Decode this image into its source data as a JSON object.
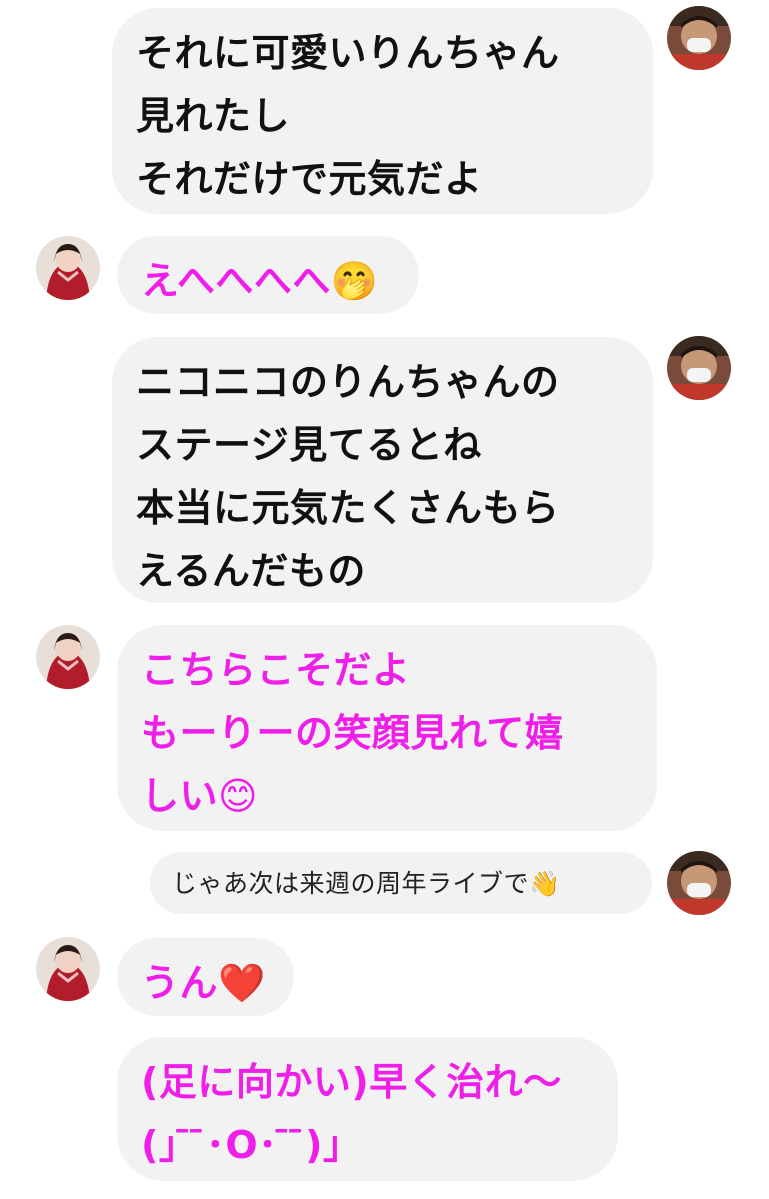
{
  "messages": [
    {
      "side": "right",
      "text": "それに可愛いりんちゃん\n見れたし\nそれだけで元気だよ"
    },
    {
      "side": "left",
      "text": "えへへへへ🤭"
    },
    {
      "side": "right",
      "text": "ニコニコのりんちゃんの\nステージ見てるとね\n本当に元気たくさんもら\nえるんだもの"
    },
    {
      "side": "left",
      "text": "こちらこそだよ\nもーりーの笑顔見れて嬉\nしい😊"
    },
    {
      "side": "right",
      "text": "じゃあ次は来週の周年ライブで👋"
    },
    {
      "side": "left",
      "text": "うん❤️"
    },
    {
      "side": "left",
      "text": "(足に向かい)早く治れ〜\n(｣ ̄ ̄･O･ ̄ ̄)｣"
    }
  ],
  "avatars": {
    "user": "masked-man-avatar",
    "idol": "kimono-girl-avatar"
  },
  "colors": {
    "bubble_bg": "#f2f2f3",
    "user_text": "#111111",
    "idol_text": "#ef1ee8"
  }
}
